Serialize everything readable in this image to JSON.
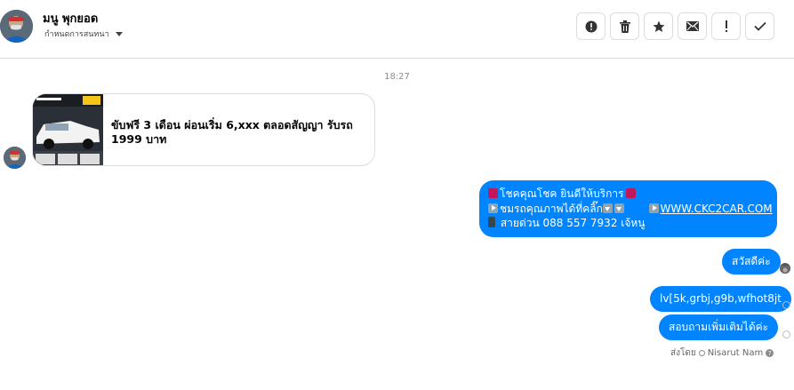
{
  "header": {
    "contact_name": "มนู พุกยอด",
    "assign_label": "กำหนดการสนทนา",
    "actions": [
      {
        "name": "alert-icon",
        "glyph": "!"
      },
      {
        "name": "trash-icon",
        "glyph": "🗑"
      },
      {
        "name": "star-icon",
        "glyph": "★"
      },
      {
        "name": "mail-icon",
        "glyph": "✉"
      },
      {
        "name": "exclamation-icon",
        "glyph": "!"
      },
      {
        "name": "check-icon",
        "glyph": "✓"
      }
    ]
  },
  "thread": {
    "timestamp": "18:27",
    "incoming_card": {
      "text": "ขับฟรี 3 เดือน ผ่อนเริ่ม 6,xxx ตลอดสัญญา รับรถ 1999 บาท"
    },
    "outgoing_big": {
      "line1": "โชคคุณโชค ยินดีให้บริการ",
      "line2a": "ชมรถคุณภาพได้ที่คลิ๊ก",
      "line2b": "WWW.CKC2CAR.COM",
      "line3": "สายด่วน 088 557 7932 เจ้หนู"
    },
    "outgoing_messages": [
      "สวัสดีค่ะ",
      "lv[5k,grbj,g9b,wfhot8jt",
      "สอบถามเพิ่มเติมได้ค่ะ"
    ],
    "sent_by_label": "ส่งโดย",
    "sent_by_name": "Nisarut Nam"
  }
}
